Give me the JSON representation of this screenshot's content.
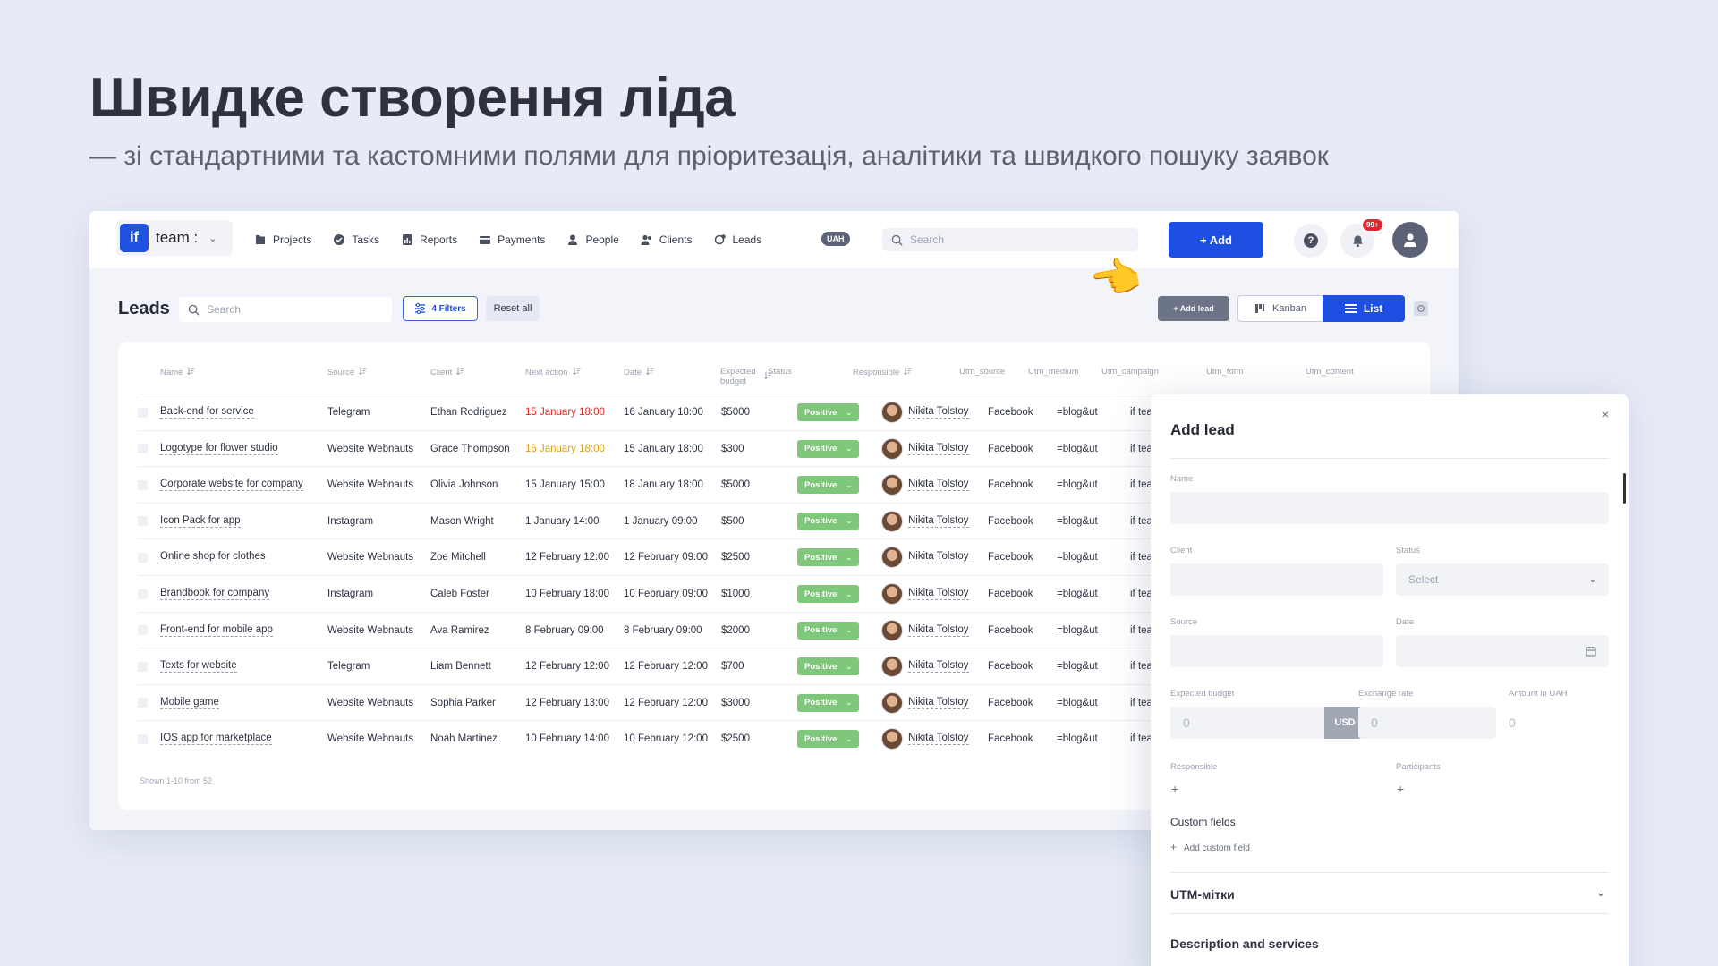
{
  "hero": {
    "title": "Швидке створення ліда",
    "subtitle": "— зі стандартними та кастомними полями для пріоритезація, аналітики та швидкого пошуку заявок"
  },
  "topbar": {
    "logo_text": "if",
    "team_name": "team :",
    "nav": [
      {
        "label": "Projects",
        "icon": "folder-icon"
      },
      {
        "label": "Tasks",
        "icon": "check-circle-icon"
      },
      {
        "label": "Reports",
        "icon": "chart-icon"
      },
      {
        "label": "Payments",
        "icon": "card-icon"
      },
      {
        "label": "People",
        "icon": "person-icon"
      },
      {
        "label": "Clients",
        "icon": "people-icon"
      },
      {
        "label": "Leads",
        "icon": "leads-icon"
      }
    ],
    "currency_badge": "UAH",
    "search_placeholder": "Search",
    "add_button": "+ Add",
    "help_label": "?",
    "notifications_badge": "99+"
  },
  "toolbar": {
    "title": "Leads",
    "search_placeholder": "Search",
    "filters_label": "4 Filters",
    "reset_label": "Reset all",
    "add_lead_label": "+ Add lead",
    "kanban_label": "Kanban",
    "list_label": "List"
  },
  "table": {
    "columns": [
      "Name",
      "Source",
      "Client",
      "Next action",
      "Expected budget",
      "Status",
      "Responsible",
      "Utm_source",
      "Utm_medium",
      "Utm_campaign",
      "Utm_form",
      "Utm_content"
    ],
    "date_column": "Date",
    "rows": [
      {
        "name": "Back-end for service",
        "source": "Telegram",
        "client": "Ethan Rodriguez",
        "next_action": "15 January 18:00",
        "next_color": "#e02424",
        "date": "16 January 18:00",
        "budget": "$5000",
        "status": "Positive",
        "responsible": "Nikita Tolstoy",
        "utm_source": "Facebook",
        "utm_medium": "=blog&ut",
        "utm_campaign": "if tea"
      },
      {
        "name": "Logotype for flower studio",
        "source": "Website Webnauts",
        "client": "Grace Thompson",
        "next_action": "16 January 18:00",
        "next_color": "#d4a017",
        "date": "15 January 18:00",
        "budget": "$300",
        "status": "Positive",
        "responsible": "Nikita Tolstoy",
        "utm_source": "Facebook",
        "utm_medium": "=blog&ut",
        "utm_campaign": "if tea"
      },
      {
        "name": "Corporate website for company",
        "source": "Website Webnauts",
        "client": "Olivia Johnson",
        "next_action": "15 January 15:00",
        "next_color": "#2d3140",
        "date": "18 January 18:00",
        "budget": "$5000",
        "status": "Positive",
        "responsible": "Nikita Tolstoy",
        "utm_source": "Facebook",
        "utm_medium": "=blog&ut",
        "utm_campaign": "if tea"
      },
      {
        "name": "Icon Pack for app",
        "source": "Instagram",
        "client": "Mason Wright",
        "next_action": "1 January 14:00",
        "next_color": "#2d3140",
        "date": "1 January 09:00",
        "budget": "$500",
        "status": "Positive",
        "responsible": "Nikita Tolstoy",
        "utm_source": "Facebook",
        "utm_medium": "=blog&ut",
        "utm_campaign": "if tea"
      },
      {
        "name": "Online shop for clothes",
        "source": "Website Webnauts",
        "client": "Zoe Mitchell",
        "next_action": "12 February 12:00",
        "next_color": "#2d3140",
        "date": "12 February 09:00",
        "budget": "$2500",
        "status": "Positive",
        "responsible": "Nikita Tolstoy",
        "utm_source": "Facebook",
        "utm_medium": "=blog&ut",
        "utm_campaign": "if tea"
      },
      {
        "name": "Brandbook for company",
        "source": "Instagram",
        "client": "Caleb Foster",
        "next_action": "10 February 18:00",
        "next_color": "#2d3140",
        "date": "10 February 09:00",
        "budget": "$1000",
        "status": "Positive",
        "responsible": "Nikita Tolstoy",
        "utm_source": "Facebook",
        "utm_medium": "=blog&ut",
        "utm_campaign": "if tea"
      },
      {
        "name": "Front-end for mobile app",
        "source": "Website Webnauts",
        "client": "Ava Ramirez",
        "next_action": "8 February 09:00",
        "next_color": "#2d3140",
        "date": "8 February 09:00",
        "budget": "$2000",
        "status": "Positive",
        "responsible": "Nikita Tolstoy",
        "utm_source": "Facebook",
        "utm_medium": "=blog&ut",
        "utm_campaign": "if tea"
      },
      {
        "name": "Texts for website",
        "source": "Telegram",
        "client": "Liam Bennett",
        "next_action": "12 February 12:00",
        "next_color": "#2d3140",
        "date": "12 February 12:00",
        "budget": "$700",
        "status": "Positive",
        "responsible": "Nikita Tolstoy",
        "utm_source": "Facebook",
        "utm_medium": "=blog&ut",
        "utm_campaign": "if tea"
      },
      {
        "name": "Mobile game",
        "source": "Website Webnauts",
        "client": "Sophia Parker",
        "next_action": "12 February 13:00",
        "next_color": "#2d3140",
        "date": "12 February 12:00",
        "budget": "$3000",
        "status": "Positive",
        "responsible": "Nikita Tolstoy",
        "utm_source": "Facebook",
        "utm_medium": "=blog&ut",
        "utm_campaign": "if tea"
      },
      {
        "name": "IOS app for marketplace",
        "source": "Website Webnauts",
        "client": "Noah Martinez",
        "next_action": "10 February 14:00",
        "next_color": "#2d3140",
        "date": "10 February 12:00",
        "budget": "$2500",
        "status": "Positive",
        "responsible": "Nikita Tolstoy",
        "utm_source": "Facebook",
        "utm_medium": "=blog&ut",
        "utm_campaign": "if tea"
      }
    ],
    "footer": "Shown 1-10 from 52"
  },
  "panel": {
    "title": "Add lead",
    "close": "×",
    "name_label": "Name",
    "client_label": "Client",
    "status_label": "Status",
    "status_placeholder": "Select",
    "source_label": "Source",
    "date_label": "Date",
    "budget_label": "Expected budget",
    "budget_value": "0",
    "currency": "USD",
    "rate_label": "Exchange rate",
    "rate_value": "0",
    "amount_label": "Amount in UAH",
    "amount_value": "0",
    "responsible_label": "Responsible",
    "participants_label": "Participants",
    "custom_fields_label": "Custom fields",
    "add_custom_field": "Add custom field",
    "utm_section": "UTM-мітки",
    "description_section": "Description and services"
  },
  "colors": {
    "accent": "#1e4fe3",
    "status_positive": "#7fc77a",
    "overdue": "#e02424",
    "warning": "#d4a017"
  }
}
